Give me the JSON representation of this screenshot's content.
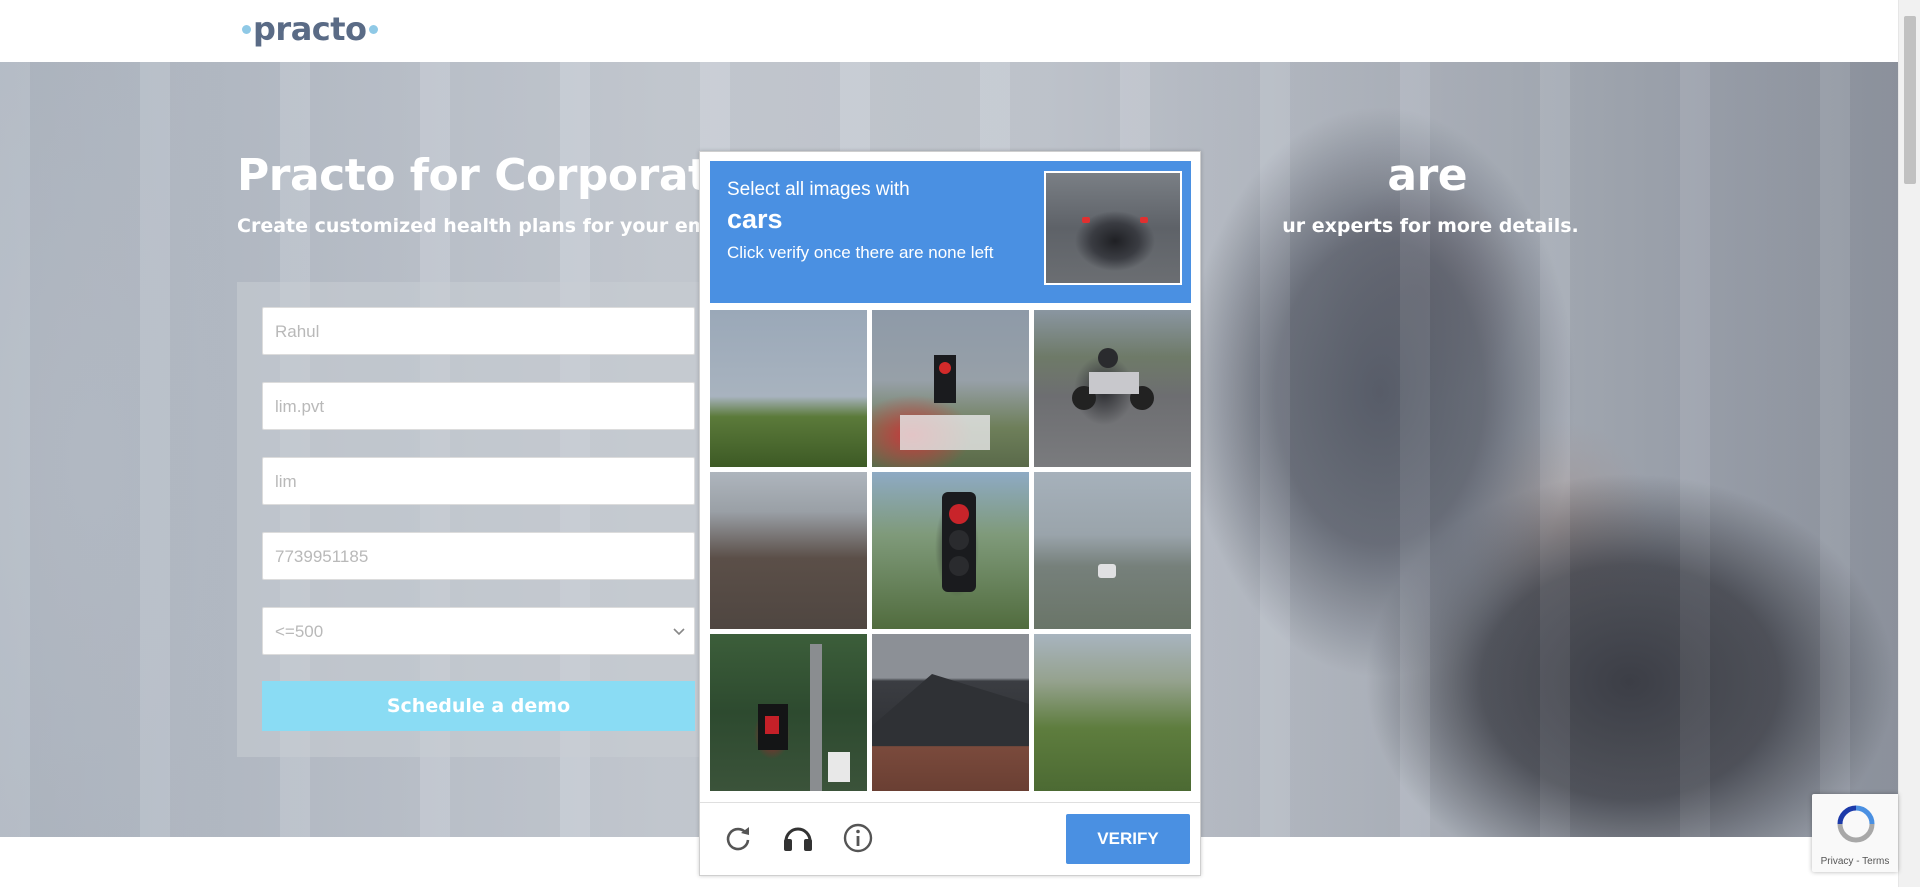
{
  "header": {
    "logo_text": "practo"
  },
  "hero": {
    "title_visible": "Practo for Corporates: O",
    "title_tail": "are",
    "subtitle_visible": "Create customized health plans for your employees",
    "subtitle_tail": "ur experts for more details."
  },
  "form": {
    "name_value": "Rahul",
    "org_value": "lim.pvt",
    "email_value": "lim",
    "phone_value": "7739951185",
    "size_selected": "<=500",
    "submit_label": "Schedule a demo"
  },
  "captcha": {
    "line1": "Select all images with",
    "target": "cars",
    "line3": "Click verify once there are none left",
    "tiles": [
      {
        "icon": "road-trees"
      },
      {
        "icon": "traffic-light-truck"
      },
      {
        "icon": "motorcycle-road"
      },
      {
        "icon": "highway"
      },
      {
        "icon": "traffic-light"
      },
      {
        "icon": "road-car"
      },
      {
        "icon": "pedestrian-light"
      },
      {
        "icon": "house-roof"
      },
      {
        "icon": "trees"
      }
    ],
    "refresh_icon": "refresh-icon",
    "audio_icon": "headphones-icon",
    "info_icon": "info-icon",
    "verify_label": "VERIFY",
    "colors": {
      "accent": "#4a90e2"
    }
  },
  "recaptcha_badge": {
    "links": "Privacy - Terms"
  },
  "colors": {
    "demo_button": "#8adcf4",
    "brand_text": "#5a6b86",
    "brand_dot": "#8fc9e6"
  }
}
